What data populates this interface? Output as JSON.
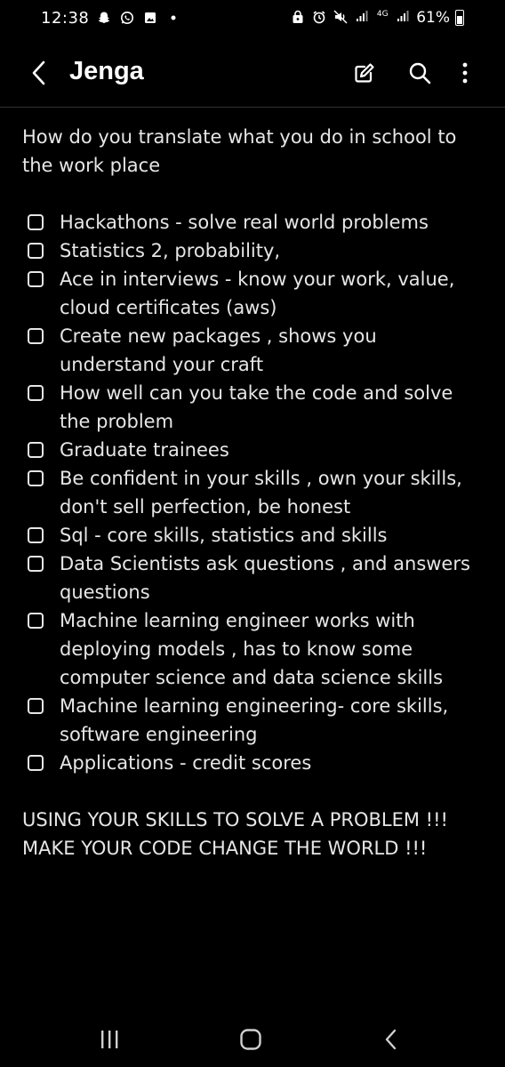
{
  "status_bar": {
    "time": "12:38",
    "left_icons": [
      "snapchat-icon",
      "whatsapp-icon",
      "gallery-icon",
      "notification-dot-icon"
    ],
    "right_icons": [
      "alarm-lock-icon",
      "alarm-icon",
      "mute-icon",
      "signal-icon",
      "network-4g-icon",
      "signal-icon"
    ],
    "network_label": "4G",
    "battery": "61%"
  },
  "app_bar": {
    "title": "Jenga",
    "back_icon": "chevron-left-icon",
    "actions": [
      "edit-icon",
      "search-icon",
      "more-vert-icon"
    ]
  },
  "note": {
    "intro": "How do you translate what you do in school to the work place",
    "items": [
      {
        "label": "Hackathons - solve real world problems",
        "checked": false
      },
      {
        "label": "Statistics 2, probability,",
        "checked": false
      },
      {
        "label": "Ace in interviews - know your work, value, cloud certificates (aws)",
        "checked": false
      },
      {
        "label": "Create new packages , shows you understand your craft",
        "checked": false
      },
      {
        "label": "How well can you take the code and solve the problem",
        "checked": false
      },
      {
        "label": "Graduate trainees",
        "checked": false
      },
      {
        "label": "Be confident in your skills , own your skills, don't sell perfection, be honest",
        "checked": false
      },
      {
        "label": "Sql - core skills, statistics and skills",
        "checked": false
      },
      {
        "label": "Data Scientists ask questions , and answers questions",
        "checked": false
      },
      {
        "label": "Machine learning engineer works with deploying models , has to know some computer science and data science skills",
        "checked": false
      },
      {
        "label": "Machine learning engineering- core skills, software engineering",
        "checked": false
      },
      {
        "label": "Applications - credit scores",
        "checked": false
      }
    ],
    "closing_line_1": "USING YOUR SKILLS TO SOLVE A PROBLEM !!!",
    "closing_line_2": "MAKE YOUR CODE CHANGE THE WORLD !!!"
  },
  "nav_bar": {
    "icons": [
      "recents-icon",
      "home-icon",
      "back-icon"
    ]
  },
  "colors": {
    "background": "#000000",
    "text": "#e6e6e6",
    "divider": "#333333"
  }
}
